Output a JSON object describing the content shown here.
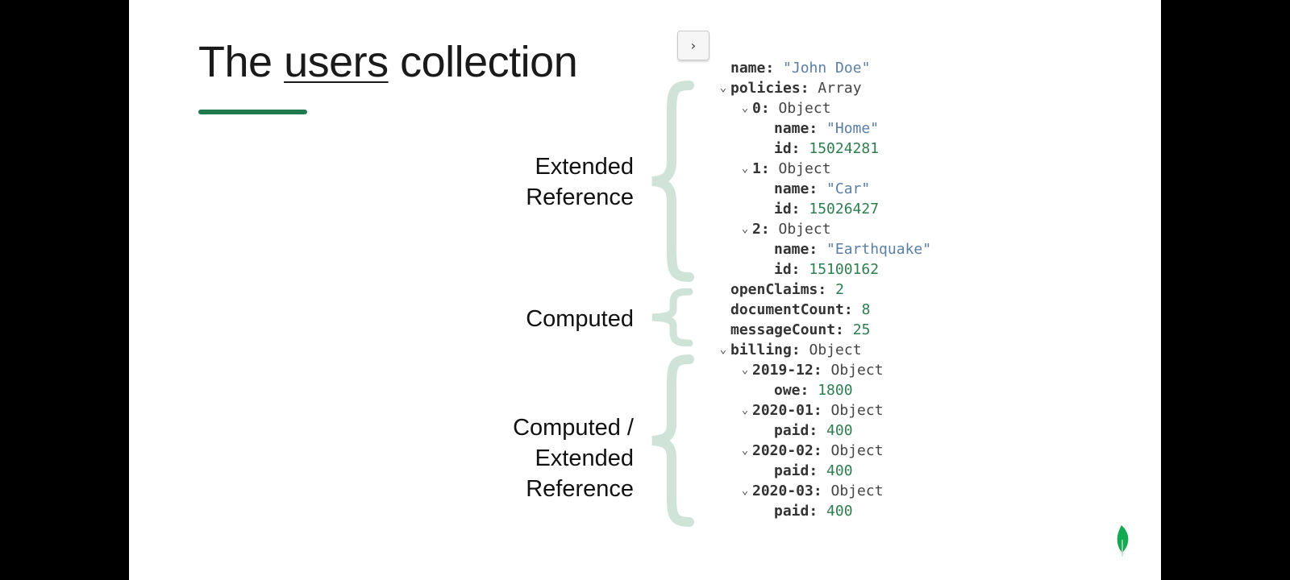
{
  "slide": {
    "title_prefix": "The ",
    "title_underlined": "users",
    "title_suffix": " collection",
    "accent_color": "#1f7a4d",
    "brace_color": "#cfe3d9"
  },
  "nav": {
    "next_icon": "chevron-right-icon",
    "next_label": "›"
  },
  "labels": {
    "extended_reference_1": "Extended",
    "extended_reference_2": "Reference",
    "computed": "Computed",
    "mixed_1": "Computed /",
    "mixed_2": "Extended",
    "mixed_3": "Reference"
  },
  "document": {
    "name_key": "name:",
    "name_val": "\"John Doe\"",
    "policies_key": "policies:",
    "policies_type": "Array",
    "p0_key": "0:",
    "p0_type": "Object",
    "p0_name_key": "name:",
    "p0_name_val": "\"Home\"",
    "p0_id_key": "id:",
    "p0_id_val": "15024281",
    "p1_key": "1:",
    "p1_type": "Object",
    "p1_name_key": "name:",
    "p1_name_val": "\"Car\"",
    "p1_id_key": "id:",
    "p1_id_val": "15026427",
    "p2_key": "2:",
    "p2_type": "Object",
    "p2_name_key": "name:",
    "p2_name_val": "\"Earthquake\"",
    "p2_id_key": "id:",
    "p2_id_val": "15100162",
    "open_claims_key": "openClaims:",
    "open_claims_val": "2",
    "document_count_key": "documentCount:",
    "document_count_val": "8",
    "message_count_key": "messageCount:",
    "message_count_val": "25",
    "billing_key": "billing:",
    "billing_type": "Object",
    "b1_key": "2019-12:",
    "b1_type": "Object",
    "b1_sub_key": "owe:",
    "b1_sub_val": "1800",
    "b2_key": "2020-01:",
    "b2_type": "Object",
    "b2_sub_key": "paid:",
    "b2_sub_val": "400",
    "b3_key": "2020-02:",
    "b3_type": "Object",
    "b3_sub_key": "paid:",
    "b3_sub_val": "400",
    "b4_key": "2020-03:",
    "b4_type": "Object",
    "b4_sub_key": "paid:",
    "b4_sub_val": "400"
  },
  "logo": {
    "icon": "leaf-logo-icon",
    "color": "#13aa52"
  }
}
